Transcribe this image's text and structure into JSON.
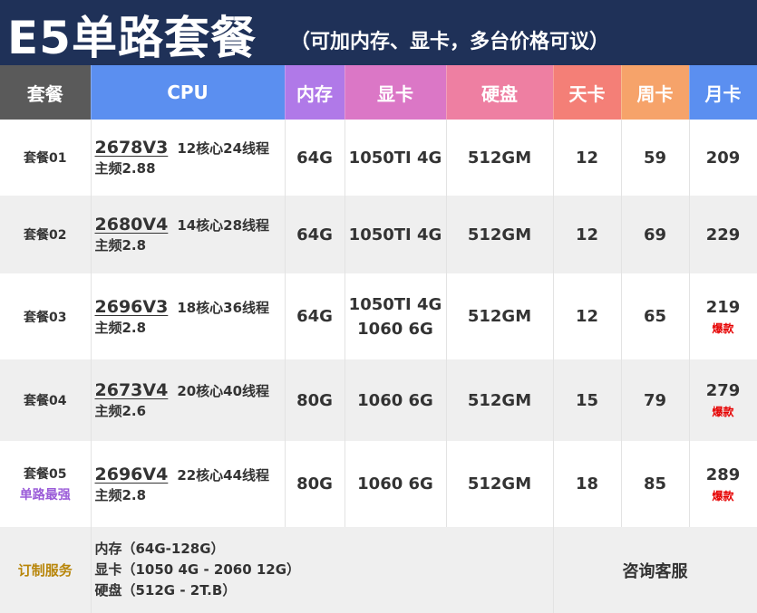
{
  "banner": {
    "title": "E5单路套餐",
    "note": "（可加内存、显卡，多台价格可议）"
  },
  "colors": {
    "banner_bg": "#1f3158",
    "header_package": "#5a5a5a",
    "header_cpu": "#5b8ff0",
    "header_memory": "#b079e8",
    "header_gpu": "#db77c6",
    "header_disk": "#ee7fa2",
    "header_day": "#f47f77",
    "header_week": "#f6a36a",
    "header_month": "#5b8ff0",
    "hot_badge": "#e60000",
    "featured_label": "#9a5bd8",
    "custom_label": "#b8860b"
  },
  "headers": {
    "package": "套餐",
    "cpu": "CPU",
    "memory": "内存",
    "gpu": "显卡",
    "disk": "硬盘",
    "day": "天卡",
    "week": "周卡",
    "month": "月卡"
  },
  "rows": [
    {
      "name": "套餐01",
      "cpu_model": "2678V3",
      "cpu_cores": "12核心24线程",
      "cpu_freq": "主频2.88",
      "memory": "64G",
      "gpu": [
        "1050TI 4G"
      ],
      "disk": "512GM",
      "day": "12",
      "week": "59",
      "month": "209"
    },
    {
      "name": "套餐02",
      "cpu_model": "2680V4",
      "cpu_cores": "14核心28线程",
      "cpu_freq": "主频2.8",
      "memory": "64G",
      "gpu": [
        "1050TI 4G"
      ],
      "disk": "512GM",
      "day": "12",
      "week": "69",
      "month": "229"
    },
    {
      "name": "套餐03",
      "cpu_model": "2696V3",
      "cpu_cores": "18核心36线程",
      "cpu_freq": "主频2.8",
      "memory": "64G",
      "gpu": [
        "1050TI 4G",
        "1060 6G"
      ],
      "disk": "512GM",
      "day": "12",
      "week": "65",
      "month": "219",
      "badge": "爆款"
    },
    {
      "name": "套餐04",
      "cpu_model": "2673V4",
      "cpu_cores": "20核心40线程",
      "cpu_freq": "主频2.6",
      "memory": "80G",
      "gpu": [
        "1060 6G"
      ],
      "disk": "512GM",
      "day": "15",
      "week": "79",
      "month": "279",
      "badge": "爆款"
    },
    {
      "name": "套餐05",
      "subtitle": "单路最强",
      "cpu_model": "2696V4",
      "cpu_cores": "22核心44线程",
      "cpu_freq": "主频2.8",
      "memory": "80G",
      "gpu": [
        "1060 6G"
      ],
      "disk": "512GM",
      "day": "18",
      "week": "85",
      "month": "289",
      "badge": "爆款"
    }
  ],
  "custom": {
    "label": "订制服务",
    "spec_memory": "内存（64G-128G）",
    "spec_gpu": "显卡（1050 4G - 2060 12G）",
    "spec_disk": "硬盘（512G - 2T.B）",
    "service": "咨询客服"
  }
}
